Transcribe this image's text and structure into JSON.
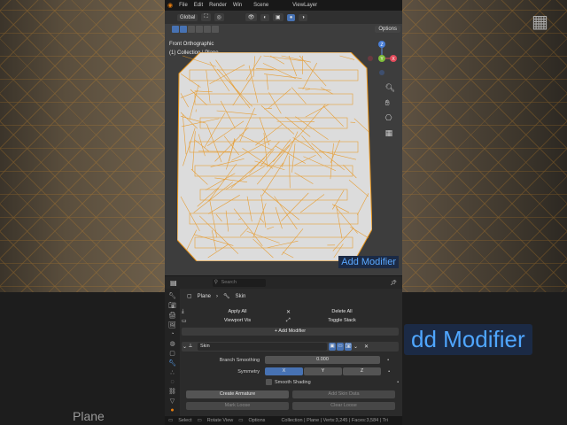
{
  "menu": {
    "items": [
      "File",
      "Edit",
      "Render",
      "Win"
    ],
    "scene": "Scene",
    "view_layer": "ViewLayer"
  },
  "header": {
    "orientation": "Global",
    "options_label": "Options"
  },
  "viewport": {
    "view_name": "Front Orthographic",
    "collection_info": "(1) Collection | Plane",
    "gizmo_axes": [
      "Z",
      "Y",
      "X"
    ],
    "overlay_text": "Add Modifier"
  },
  "properties": {
    "search_placeholder": "Search",
    "breadcrumb_object": "Plane",
    "breadcrumb_modifier": "Skin",
    "apply_all": "Apply All",
    "delete_all": "Delete All",
    "viewport_vis": "Viewport Vis",
    "toggle_stack": "Toggle Stack",
    "add_modifier": "Add Modifier",
    "modifier_name": "Skin",
    "branch_smoothing_label": "Branch Smoothing",
    "branch_smoothing_value": "0.000",
    "symmetry_label": "Symmetry",
    "symmetry_axes": [
      "X",
      "Y",
      "Z"
    ],
    "smooth_shading": "Smooth Shading",
    "create_armature": "Create Armature",
    "add_skin_data": "Add Skin Data",
    "mark_loose": "Mark Loose",
    "clear_loose": "Clear Loose"
  },
  "status": {
    "select": "Select",
    "rotate_view": "Rotate View",
    "options": "Options",
    "stats": "Collection | Plane | Verts:3,245 | Faces:3,584 | Tri"
  },
  "background": {
    "big_text": "dd Modifier",
    "plane_text": "Plane"
  },
  "colors": {
    "accent": "#4772b3",
    "wire": "#e8941a",
    "mesh": "#d9d9d9"
  }
}
